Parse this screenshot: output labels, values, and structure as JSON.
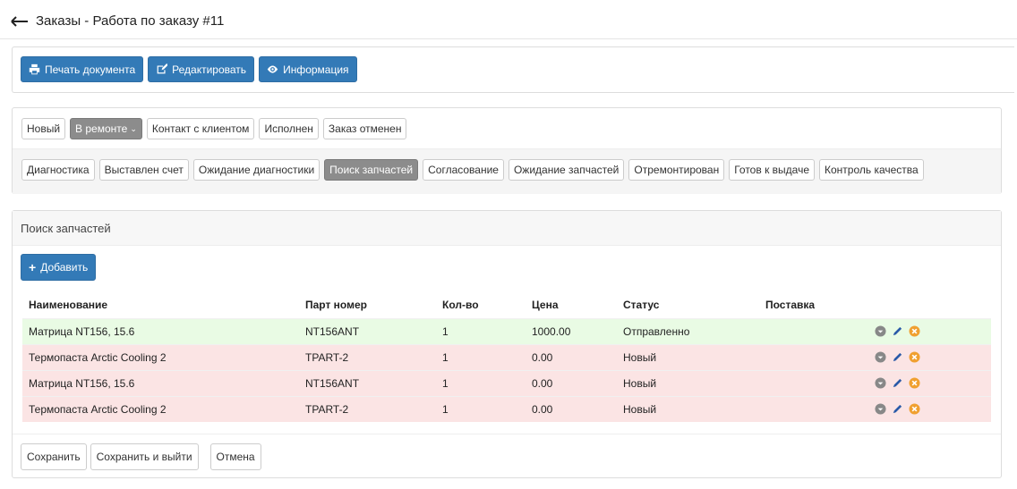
{
  "header": {
    "title": "Заказы - Работа по заказу #11"
  },
  "toolbar": {
    "print_label": "Печать документа",
    "edit_label": "Редактировать",
    "info_label": "Информация"
  },
  "status_main": [
    {
      "label": "Новый",
      "active": false
    },
    {
      "label": "В ремонте",
      "active": true
    },
    {
      "label": "Контакт с клиентом",
      "active": false
    },
    {
      "label": "Исполнен",
      "active": false
    },
    {
      "label": "Заказ отменен",
      "active": false
    }
  ],
  "status_sub": [
    {
      "label": "Диагностика",
      "active": false
    },
    {
      "label": "Выставлен счет",
      "active": false
    },
    {
      "label": "Ожидание диагностики",
      "active": false
    },
    {
      "label": "Поиск запчастей",
      "active": true
    },
    {
      "label": "Согласование",
      "active": false
    },
    {
      "label": "Ожидание запчастей",
      "active": false
    },
    {
      "label": "Отремонтирован",
      "active": false
    },
    {
      "label": "Готов к выдаче",
      "active": false
    },
    {
      "label": "Контроль качества",
      "active": false
    }
  ],
  "parts": {
    "title": "Поиск запчастей",
    "add_label": "Добавить",
    "columns": [
      "Наименование",
      "Парт номер",
      "Кол-во",
      "Цена",
      "Статус",
      "Поставка"
    ],
    "rows": [
      {
        "name": "Матрица NT156, 15.6",
        "part": "NT156ANT",
        "qty": "1",
        "price": "1000.00",
        "status": "Отправленно",
        "supply": "",
        "state": "green"
      },
      {
        "name": "Термопаста Arctic Cooling 2",
        "part": "TPART-2",
        "qty": "1",
        "price": "0.00",
        "status": "Новый",
        "supply": "",
        "state": "red"
      },
      {
        "name": "Матрица NT156, 15.6",
        "part": "NT156ANT",
        "qty": "1",
        "price": "0.00",
        "status": "Новый",
        "supply": "",
        "state": "red"
      },
      {
        "name": "Термопаста Arctic Cooling 2",
        "part": "TPART-2",
        "qty": "1",
        "price": "0.00",
        "status": "Новый",
        "supply": "",
        "state": "red"
      }
    ]
  },
  "footer": {
    "save_label": "Сохранить",
    "save_exit_label": "Сохранить и выйти",
    "cancel_label": "Отмена"
  },
  "colors": {
    "primary": "#337ab7",
    "active_status": "#8c8c8c",
    "row_green": "#e9fbe4",
    "row_red": "#fbe4e4",
    "delete_icon": "#f0a030",
    "edit_icon": "#2a5aa8"
  }
}
